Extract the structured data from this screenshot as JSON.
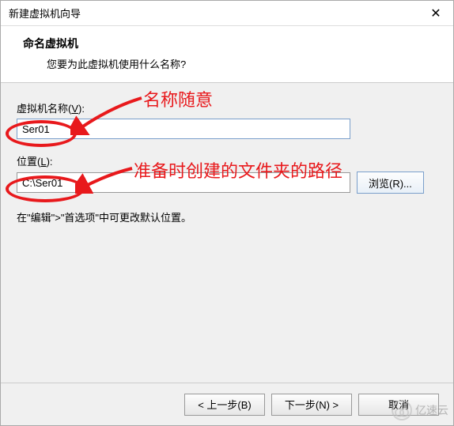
{
  "titlebar": {
    "title": "新建虚拟机向导",
    "close": "✕"
  },
  "header": {
    "title": "命名虚拟机",
    "subtitle": "您要为此虚拟机使用什么名称?"
  },
  "fields": {
    "name": {
      "label_prefix": "虚拟机名称(",
      "label_key": "V",
      "label_suffix": "):",
      "value": "Ser01"
    },
    "location": {
      "label_prefix": "位置(",
      "label_key": "L",
      "label_suffix": "):",
      "value": "C:\\Ser01"
    },
    "browse_btn": "浏览(R)..."
  },
  "hint": "在\"编辑\">\"首选项\"中可更改默认位置。",
  "footer": {
    "back": "< 上一步(B)",
    "next": "下一步(N) >",
    "cancel": "取消"
  },
  "annotations": {
    "name_hint": "名称随意",
    "loc_hint": "准备时创建的文件夹的路径",
    "color": "#e8191c"
  },
  "watermark": "亿速云"
}
